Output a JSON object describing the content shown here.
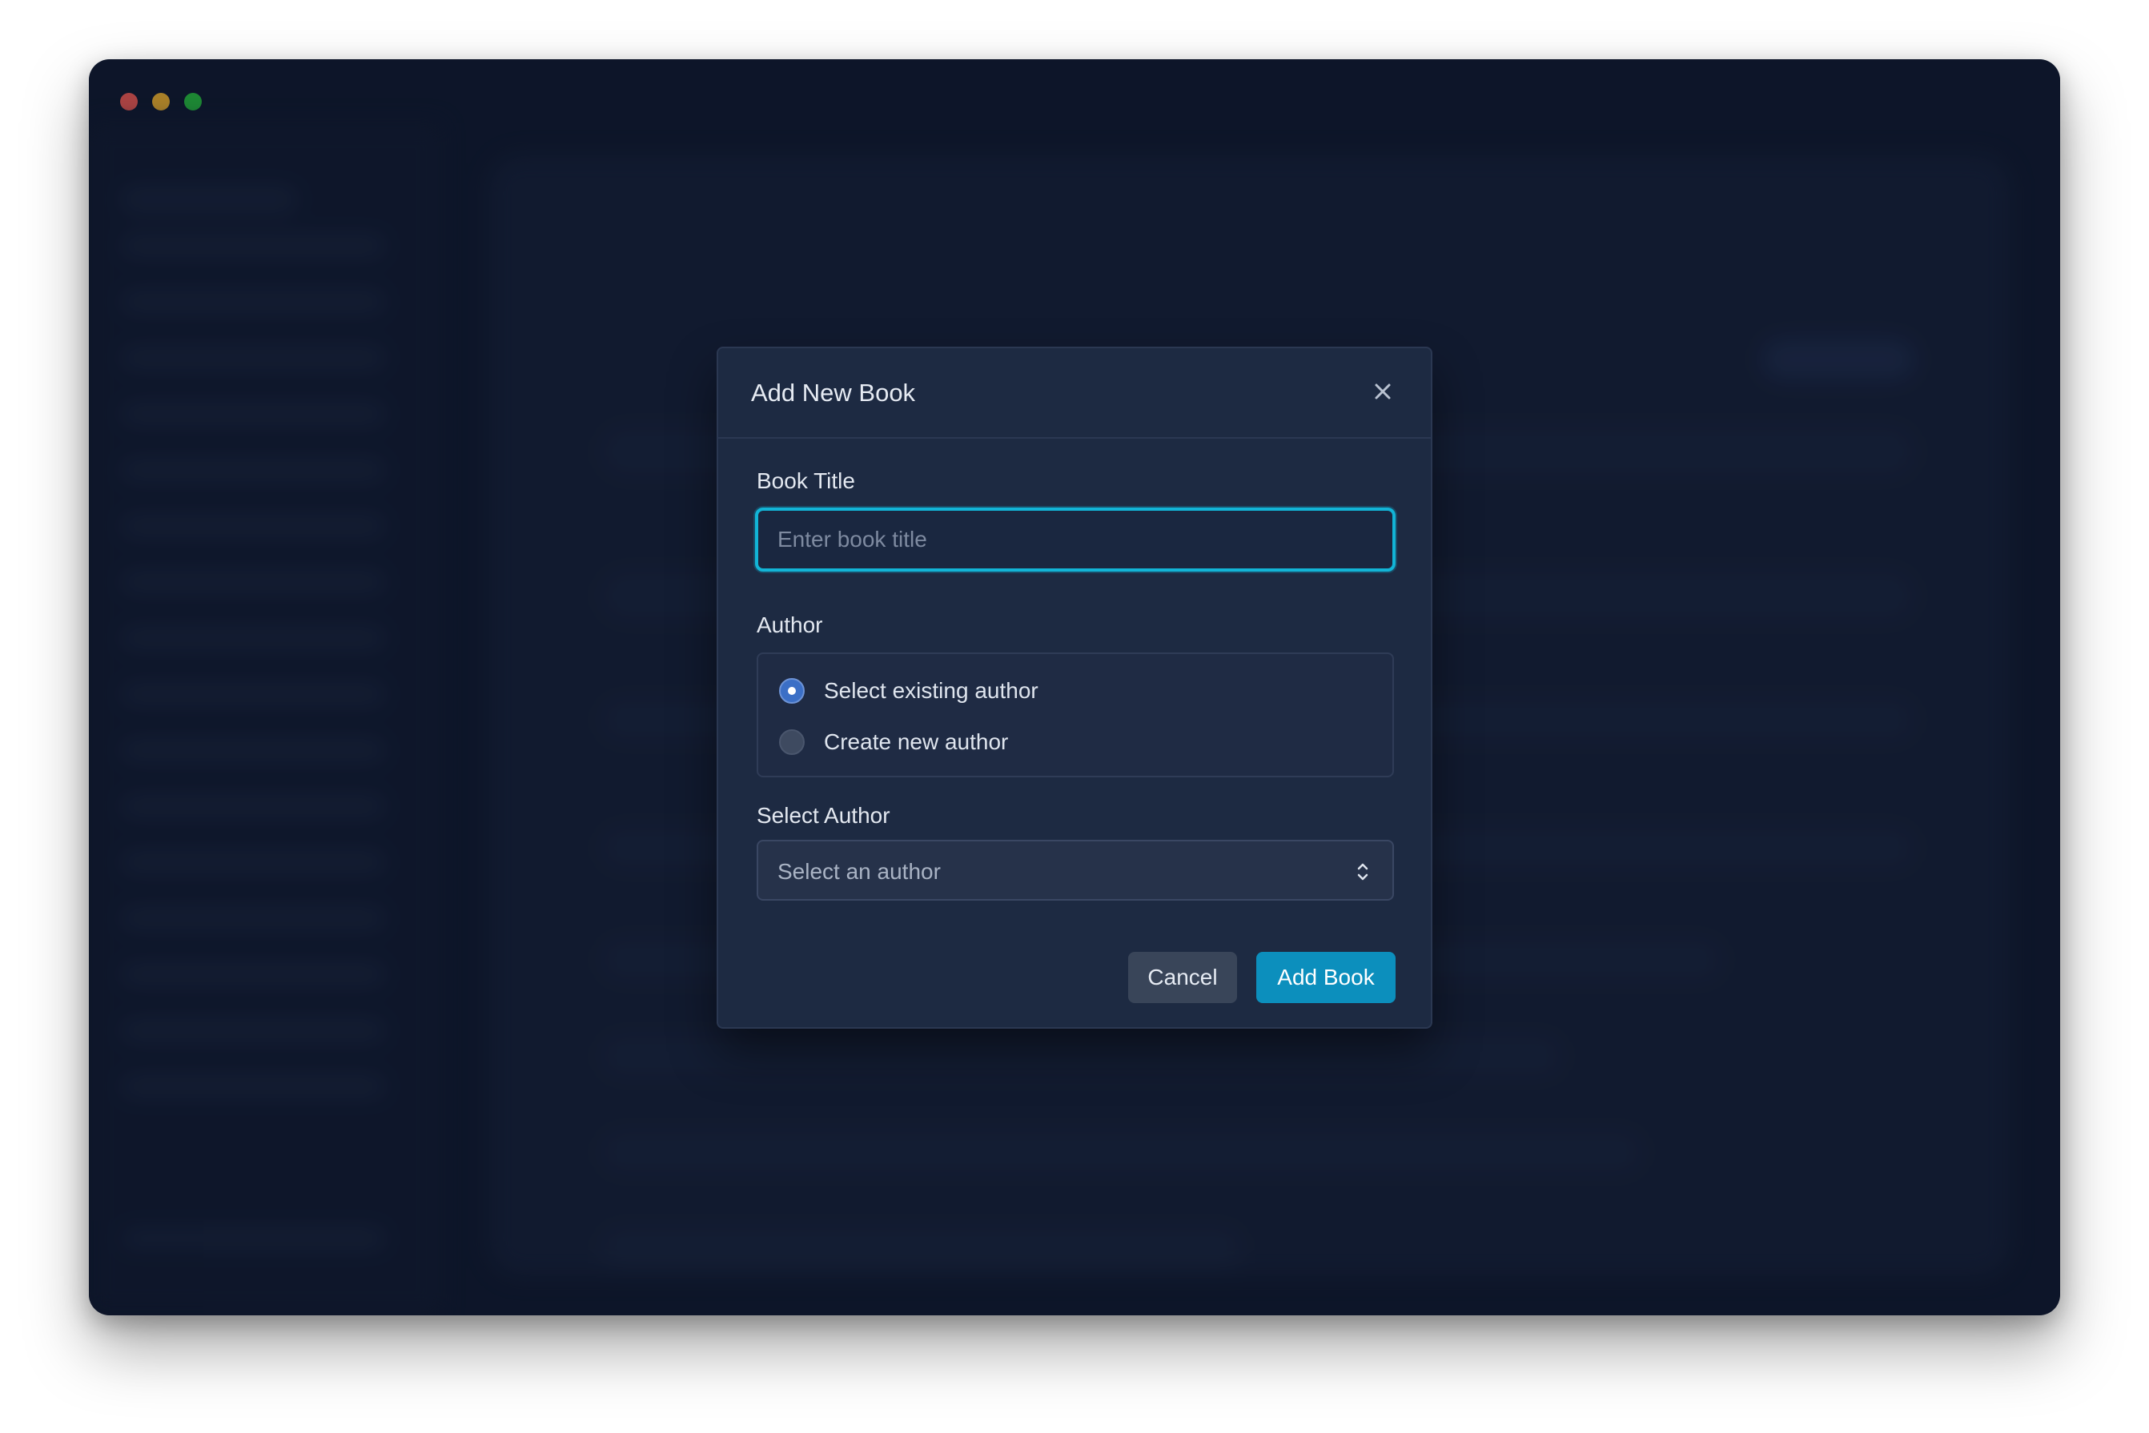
{
  "window": {
    "controls": [
      "close",
      "minimize",
      "zoom"
    ]
  },
  "modal": {
    "title": "Add New Book",
    "close_icon": "close-icon",
    "book_title": {
      "label": "Book Title",
      "placeholder": "Enter book title",
      "value": ""
    },
    "author": {
      "label": "Author",
      "options": [
        {
          "label": "Select existing author",
          "checked": true
        },
        {
          "label": "Create new author",
          "checked": false
        }
      ]
    },
    "select_author": {
      "label": "Select Author",
      "selected": "Select an author",
      "icon": "chevron-up-down-icon"
    },
    "buttons": {
      "cancel": "Cancel",
      "submit": "Add Book"
    }
  },
  "colors": {
    "accent": "#12b4d6",
    "primary_button": "#0c8fbd",
    "modal_bg": "#1d2a42",
    "window_bg": "#101a30"
  }
}
